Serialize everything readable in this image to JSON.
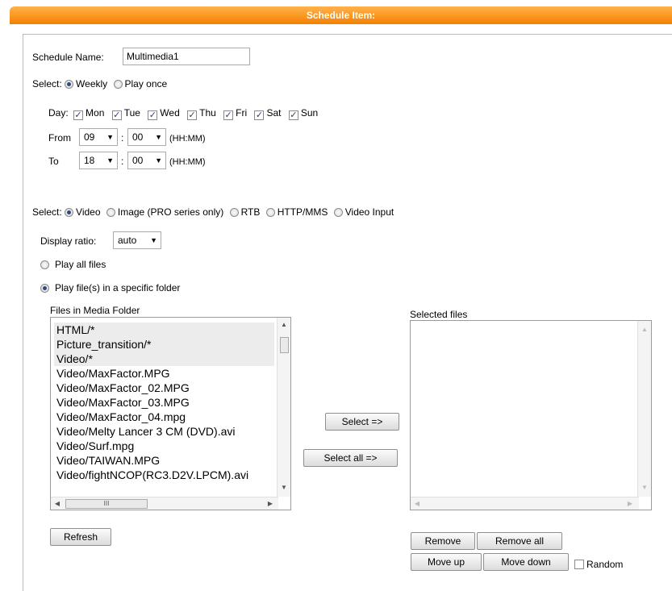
{
  "header": {
    "title": "Schedule Item:"
  },
  "schedule_name": {
    "label": "Schedule Name:",
    "value": "Multimedia1"
  },
  "select_mode": {
    "label": "Select:",
    "weekly": "Weekly",
    "play_once": "Play once",
    "selected": "Weekly"
  },
  "day": {
    "label": "Day:",
    "days": [
      {
        "label": "Mon",
        "checked": true
      },
      {
        "label": "Tue",
        "checked": true
      },
      {
        "label": "Wed",
        "checked": true
      },
      {
        "label": "Thu",
        "checked": true
      },
      {
        "label": "Fri",
        "checked": true
      },
      {
        "label": "Sat",
        "checked": true
      },
      {
        "label": "Sun",
        "checked": true
      }
    ]
  },
  "from": {
    "label": "From",
    "hour": "09",
    "minute": "00",
    "sep": ":",
    "hint": "(HH:MM)"
  },
  "to": {
    "label": "To",
    "hour": "18",
    "minute": "00",
    "sep": ":",
    "hint": "(HH:MM)"
  },
  "source": {
    "label": "Select:",
    "options": [
      "Video",
      "Image (PRO series only)",
      "RTB",
      "HTTP/MMS",
      "Video Input"
    ],
    "selected": "Video"
  },
  "display_ratio": {
    "label": "Display ratio:",
    "value": "auto"
  },
  "play_mode": {
    "all": "Play all files",
    "folder": "Play file(s) in a specific folder",
    "selected": "folder"
  },
  "media_folder": {
    "title": "Files in Media Folder",
    "items": [
      "HTML/*",
      "Picture_transition/*",
      "Video/*",
      "Video/MaxFactor.MPG",
      "Video/MaxFactor_02.MPG",
      "Video/MaxFactor_03.MPG",
      "Video/MaxFactor_04.mpg",
      "Video/Melty Lancer 3 CM (DVD).avi",
      "Video/Surf.mpg",
      "Video/TAIWAN.MPG",
      "Video/fightNCOP(RC3.D2V.LPCM).avi"
    ],
    "scroll_thumb_label": "III"
  },
  "selected_files": {
    "title": "Selected files",
    "items": []
  },
  "buttons": {
    "select": "Select =>",
    "select_all": "Select all =>",
    "refresh": "Refresh",
    "remove": "Remove",
    "remove_all": "Remove all",
    "move_up": "Move up",
    "move_down": "Move down"
  },
  "random": {
    "label": "Random",
    "checked": false
  },
  "colors": {
    "header_top": "#ffb24a",
    "header_bottom": "#f47f00",
    "header_text": "#ffffff"
  }
}
